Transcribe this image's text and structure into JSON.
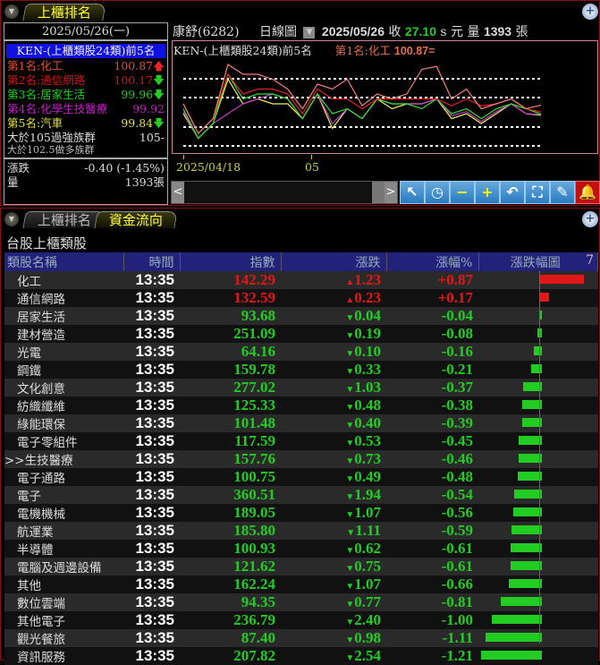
{
  "top": {
    "tabs": [
      {
        "label": "上櫃排名",
        "active": true
      }
    ],
    "date": "2025/05/26(一)",
    "rank_title": "KEN-(上櫃類股24類)前5名",
    "ranks": [
      {
        "label": "第1名:化工",
        "value": "100.87",
        "arrow": "up",
        "color": "#e05030"
      },
      {
        "label": "第2名:通信網路",
        "value": "100.17",
        "arrow": "down",
        "color": "#d01818"
      },
      {
        "label": "第3名:居家生活",
        "value": "99.96",
        "arrow": "down",
        "color": "#22cc22"
      },
      {
        "label": "第4名:化學生技醫療",
        "value": "99.92",
        "arrow": "",
        "color": "#c020c0"
      },
      {
        "label": "第5名:汽車",
        "value": "99.84",
        "arrow": "down",
        "color": "#e0e040"
      }
    ],
    "strong_label": "大於105過強族群",
    "strong_value": "105-",
    "bull_label": "大於102.5做多族群",
    "change_label": "漲跌",
    "change_value": "-0.40 (-1.45%)",
    "volume_label": "量",
    "volume_value": "1393張",
    "stock": "康舒(6282)",
    "chart_type": "日線圖",
    "quote_date": "2025/05/26",
    "close_label": "收",
    "close": "27.10",
    "close_suffix": "s 元",
    "vol_label": "量",
    "vol": "1393",
    "vol_unit": "張",
    "chart_title": "KEN-(上櫃類股24類)前5名",
    "chart_legend": "第1名:化工",
    "chart_legend_value": "100.87=",
    "x_ticks": [
      "2025/04/18",
      "05"
    ],
    "toolbar": [
      "↖",
      "◷",
      "−",
      "+",
      "↶",
      "⛶",
      "✎",
      "🔔"
    ]
  },
  "chart_series": [
    {
      "name": "化工",
      "color": "#f08080",
      "values": [
        101,
        98,
        99.5,
        105,
        104,
        104,
        103.5,
        102.5,
        100.5,
        103,
        102.5,
        103.5,
        100.8,
        102,
        101.5,
        102,
        104.5,
        104.8,
        101.5,
        102.5,
        100.5,
        101,
        101.5,
        100.5,
        100.87
      ]
    },
    {
      "name": "通信網路",
      "color": "#e02020",
      "values": [
        101,
        98,
        99.5,
        104,
        102,
        102.5,
        102.5,
        102,
        100,
        102.5,
        101.5,
        101.5,
        100.5,
        101.5,
        101.5,
        101.5,
        101.5,
        101.5,
        100.8,
        101.5,
        100.8,
        101,
        101.5,
        100.5,
        100.17
      ]
    },
    {
      "name": "居家生活",
      "color": "#30e030",
      "values": [
        100.5,
        97.5,
        99,
        104,
        101.5,
        102,
        102,
        101.5,
        99.5,
        102,
        100,
        100.5,
        99.5,
        101.5,
        101,
        101,
        100.5,
        101.5,
        100,
        100.5,
        99.5,
        100.5,
        101,
        100.5,
        99.96
      ]
    },
    {
      "name": "化學生技醫療",
      "color": "#c040c0",
      "values": [
        100.2,
        97.5,
        99,
        100,
        101,
        101.5,
        102,
        101.5,
        99.5,
        102,
        99,
        100.5,
        99.5,
        101.5,
        101,
        101,
        101,
        101.5,
        99.8,
        100.2,
        99.2,
        100.2,
        101,
        100,
        99.92
      ]
    },
    {
      "name": "汽車",
      "color": "#f0f060",
      "values": [
        100,
        97.5,
        99,
        103.5,
        101,
        101.5,
        101,
        101,
        99.5,
        102,
        98.5,
        100.5,
        99.5,
        101.5,
        100.5,
        101,
        101,
        101.5,
        99.5,
        100,
        99,
        100,
        101,
        100,
        99.84
      ]
    }
  ],
  "bottom": {
    "tabs": [
      {
        "label": "上櫃排名",
        "active": false
      },
      {
        "label": "資金流向",
        "active": true
      }
    ],
    "section_title": "台股上櫃類股",
    "columns": [
      "類股名稱",
      "時間",
      "指數",
      "漲跌",
      "漲幅%",
      "漲跌幅圖"
    ],
    "sort_mark": "7",
    "rows": [
      {
        "name": "化工",
        "time": "13:35",
        "index": "142.29",
        "change": "1.23",
        "pct": "+0.87",
        "dir": "up",
        "pctnum": 0.87
      },
      {
        "name": "通信網路",
        "time": "13:35",
        "index": "132.59",
        "change": "0.23",
        "pct": "+0.17",
        "dir": "up",
        "pctnum": 0.17
      },
      {
        "name": "居家生活",
        "time": "13:35",
        "index": "93.68",
        "change": "0.04",
        "pct": "-0.04",
        "dir": "dn",
        "pctnum": -0.04
      },
      {
        "name": "建材營造",
        "time": "13:35",
        "index": "251.09",
        "change": "0.19",
        "pct": "-0.08",
        "dir": "dn",
        "pctnum": -0.08
      },
      {
        "name": "光電",
        "time": "13:35",
        "index": "64.16",
        "change": "0.10",
        "pct": "-0.16",
        "dir": "dn",
        "pctnum": -0.16
      },
      {
        "name": "鋼鐵",
        "time": "13:35",
        "index": "159.78",
        "change": "0.33",
        "pct": "-0.21",
        "dir": "dn",
        "pctnum": -0.21
      },
      {
        "name": "文化創意",
        "time": "13:35",
        "index": "277.02",
        "change": "1.03",
        "pct": "-0.37",
        "dir": "dn",
        "pctnum": -0.37
      },
      {
        "name": "紡織纖維",
        "time": "13:35",
        "index": "125.33",
        "change": "0.48",
        "pct": "-0.38",
        "dir": "dn",
        "pctnum": -0.38
      },
      {
        "name": "綠能環保",
        "time": "13:35",
        "index": "101.48",
        "change": "0.40",
        "pct": "-0.39",
        "dir": "dn",
        "pctnum": -0.39
      },
      {
        "name": "電子零組件",
        "time": "13:35",
        "index": "117.59",
        "change": "0.53",
        "pct": "-0.45",
        "dir": "dn",
        "pctnum": -0.45
      },
      {
        "name": "生技醫療",
        "time": "13:35",
        "index": "157.76",
        "change": "0.73",
        "pct": "-0.46",
        "dir": "dn",
        "pctnum": -0.46,
        "marker": ">>"
      },
      {
        "name": "電子通路",
        "time": "13:35",
        "index": "100.75",
        "change": "0.49",
        "pct": "-0.48",
        "dir": "dn",
        "pctnum": -0.48
      },
      {
        "name": "電子",
        "time": "13:35",
        "index": "360.51",
        "change": "1.94",
        "pct": "-0.54",
        "dir": "dn",
        "pctnum": -0.54
      },
      {
        "name": "電機機械",
        "time": "13:35",
        "index": "189.05",
        "change": "1.07",
        "pct": "-0.56",
        "dir": "dn",
        "pctnum": -0.56
      },
      {
        "name": "航運業",
        "time": "13:35",
        "index": "185.80",
        "change": "1.11",
        "pct": "-0.59",
        "dir": "dn",
        "pctnum": -0.59
      },
      {
        "name": "半導體",
        "time": "13:35",
        "index": "100.93",
        "change": "0.62",
        "pct": "-0.61",
        "dir": "dn",
        "pctnum": -0.61
      },
      {
        "name": "電腦及週邊設備",
        "time": "13:35",
        "index": "121.62",
        "change": "0.75",
        "pct": "-0.61",
        "dir": "dn",
        "pctnum": -0.61
      },
      {
        "name": "其他",
        "time": "13:35",
        "index": "162.24",
        "change": "1.07",
        "pct": "-0.66",
        "dir": "dn",
        "pctnum": -0.66
      },
      {
        "name": "數位雲端",
        "time": "13:35",
        "index": "94.35",
        "change": "0.77",
        "pct": "-0.81",
        "dir": "dn",
        "pctnum": -0.81
      },
      {
        "name": "其他電子",
        "time": "13:35",
        "index": "236.79",
        "change": "2.40",
        "pct": "-1.00",
        "dir": "dn",
        "pctnum": -1.0
      },
      {
        "name": "觀光餐旅",
        "time": "13:35",
        "index": "87.40",
        "change": "0.98",
        "pct": "-1.11",
        "dir": "dn",
        "pctnum": -1.11
      },
      {
        "name": "資訊服務",
        "time": "13:35",
        "index": "207.82",
        "change": "2.54",
        "pct": "-1.21",
        "dir": "dn",
        "pctnum": -1.21
      }
    ]
  },
  "colors": {
    "up": "#e01818",
    "down": "#22cc22",
    "header": "#22227a"
  }
}
